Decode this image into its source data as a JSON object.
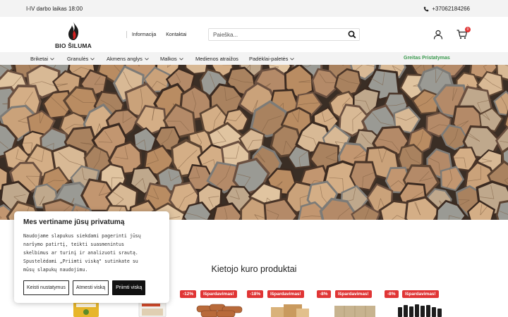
{
  "topbar": {
    "hours": "I-IV darbo laikas 18:00",
    "phone": "+37062184266"
  },
  "header": {
    "logo_text": "BIO ŠILUMA",
    "links": [
      "Informacija",
      "Kontaktai"
    ],
    "search_placeholder": "Paieška...",
    "cart_count": "0"
  },
  "nav": {
    "items": [
      {
        "label": "Briketai",
        "has_dropdown": true
      },
      {
        "label": "Granulės",
        "has_dropdown": true
      },
      {
        "label": "Akmens anglys",
        "has_dropdown": true
      },
      {
        "label": "Malkos",
        "has_dropdown": true
      },
      {
        "label": "Medienos atraižos",
        "has_dropdown": false
      },
      {
        "label": "Padėklai-paletės",
        "has_dropdown": true
      }
    ],
    "express": "Greitas Pristatymas"
  },
  "colors": {
    "accent_green": "#3a9a4e",
    "sale_red": "#e03535",
    "bar_grey": "#f3f3f3"
  },
  "section_title": "Kietojo kuro produktai",
  "products": [
    {
      "discount": "",
      "sale": "",
      "image": "pellets-bag-yellow"
    },
    {
      "discount": "",
      "sale": "",
      "image": "pellets-bag-white"
    },
    {
      "discount": "-12%",
      "sale": "Išpardavimas!",
      "image": "round-briquettes"
    },
    {
      "discount": "-18%",
      "sale": "Išpardavimas!",
      "image": "wood-blocks"
    },
    {
      "discount": "-8%",
      "sale": "Išpardavimas!",
      "image": "ruf-briquettes"
    },
    {
      "discount": "-8%",
      "sale": "Išpardavimas!",
      "image": "coal-pellets"
    }
  ],
  "cookie": {
    "title": "Mes vertiname jūsų privatumą",
    "text_lines": [
      "Naudojame slapukus siekdami pagerinti jūsų",
      "naršymo patirtį, teikti suasmenintus",
      "skelbimus ar turinį ir analizuoti srautą.",
      "Spustelėdami „Priimti viską\" sutinkate su",
      "mūsų slapukų naudojimu."
    ],
    "btn_customize": "Keisti nustatymus",
    "btn_reject": "Atmesti viską",
    "btn_accept": "Priimti viską"
  }
}
